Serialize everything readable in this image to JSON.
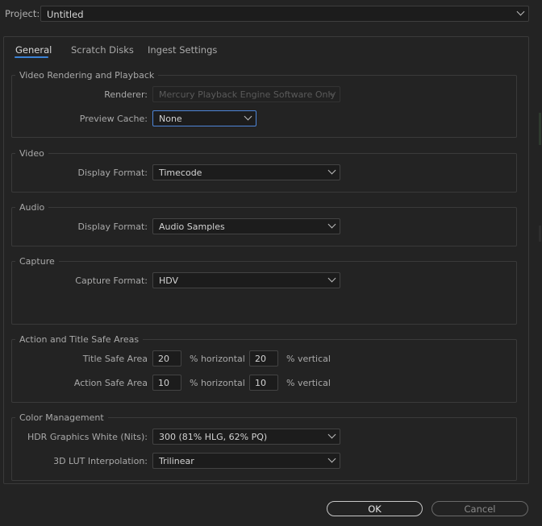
{
  "project": {
    "label": "Project:",
    "value": "Untitled"
  },
  "tabs": [
    {
      "label": "General",
      "active": true
    },
    {
      "label": "Scratch Disks",
      "active": false
    },
    {
      "label": "Ingest Settings",
      "active": false
    }
  ],
  "video_rendering": {
    "title": "Video Rendering and Playback",
    "renderer_label": "Renderer:",
    "renderer_value": "Mercury Playback Engine Software Only",
    "preview_cache_label": "Preview Cache:",
    "preview_cache_value": "None"
  },
  "video": {
    "title": "Video",
    "display_format_label": "Display Format:",
    "display_format_value": "Timecode"
  },
  "audio": {
    "title": "Audio",
    "display_format_label": "Display Format:",
    "display_format_value": "Audio Samples"
  },
  "capture": {
    "title": "Capture",
    "capture_format_label": "Capture Format:",
    "capture_format_value": "HDV"
  },
  "safe_areas": {
    "title": "Action and Title Safe Areas",
    "title_safe_label": "Title Safe Area",
    "title_safe_h": "20",
    "title_safe_v": "20",
    "action_safe_label": "Action Safe Area",
    "action_safe_h": "10",
    "action_safe_v": "10",
    "horizontal_label": "% horizontal",
    "vertical_label": "% vertical"
  },
  "color_management": {
    "title": "Color Management",
    "hdr_label": "HDR Graphics White (Nits):",
    "hdr_value": "300 (81% HLG, 62% PQ)",
    "lut_label": "3D LUT Interpolation:",
    "lut_value": "Trilinear"
  },
  "buttons": {
    "ok": "OK",
    "cancel": "Cancel"
  },
  "colors": {
    "accent": "#3b82d6",
    "background": "#232323",
    "field": "#1c1c1c"
  }
}
